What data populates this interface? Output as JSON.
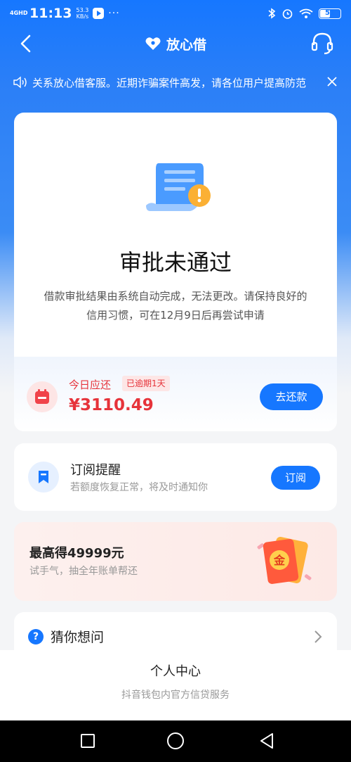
{
  "status_bar": {
    "network": "4GHD",
    "time": "11:13",
    "speed_value": "53.3",
    "speed_unit": "KB/s",
    "battery": "51"
  },
  "nav": {
    "brand": "放心借"
  },
  "notice": {
    "text": "关系放心借客服。近期诈骗案件高发，请各位用户提高防范"
  },
  "result": {
    "title": "审批未通过",
    "description": "借款审批结果由系统自动完成，无法更改。请保持良好的信用习惯，可在12月9日后再尝试申请"
  },
  "due": {
    "label": "今日应还",
    "overdue_badge": "已逾期1天",
    "amount": "¥3110.49",
    "button": "去还款"
  },
  "subscribe": {
    "title": "订阅提醒",
    "description": "若额度恢复正常，将及时通知你",
    "button": "订阅"
  },
  "promo": {
    "title": "最高得49999元",
    "description": "试手气，抽全年账单帮还",
    "badge_char": "金"
  },
  "faq": {
    "title": "猜你想问"
  },
  "footer": {
    "center": "个人中心",
    "service": "抖音钱包内官方信贷服务"
  },
  "colors": {
    "primary": "#1677ff",
    "danger": "#e6333a",
    "warning": "#fbb034"
  }
}
